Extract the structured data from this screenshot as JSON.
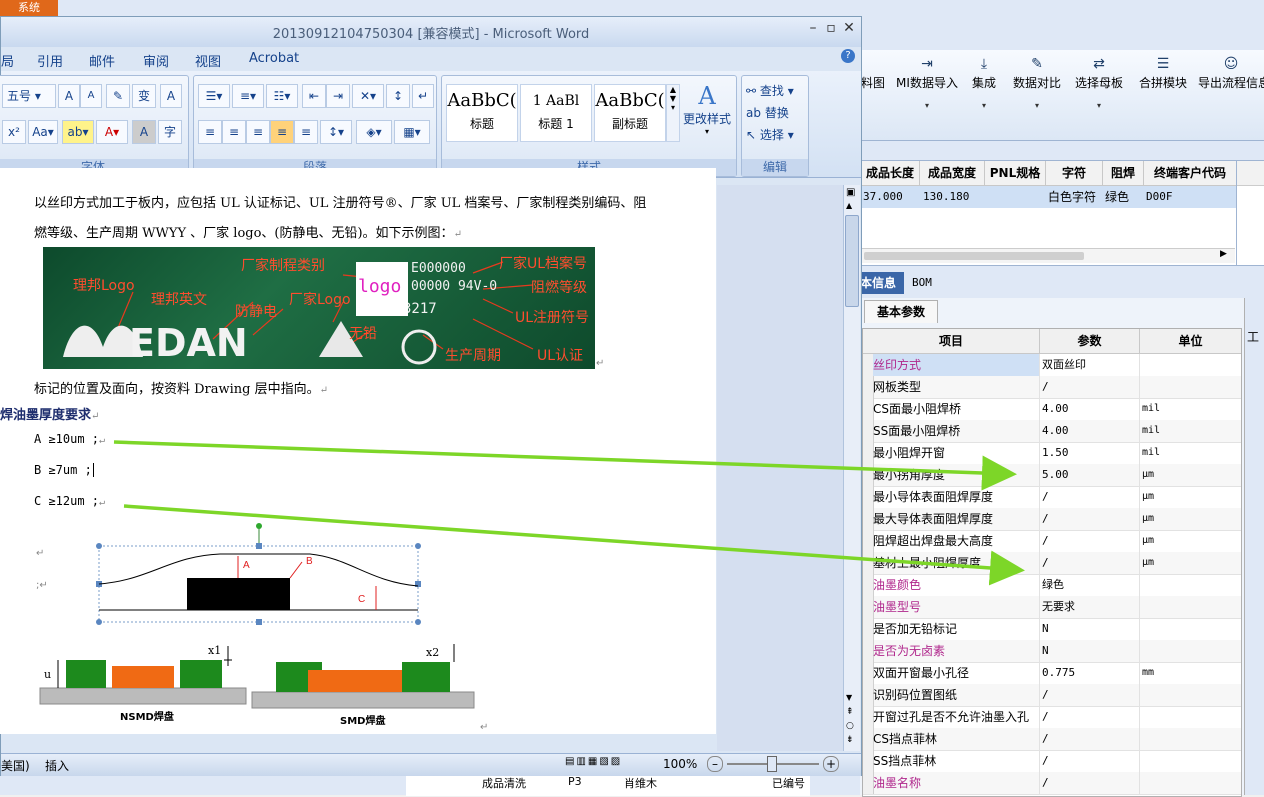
{
  "system_tab": "系统",
  "word": {
    "title": "20130912104750304 [兼容模式] - Microsoft Word",
    "menus": [
      "局",
      "引用",
      "邮件",
      "审阅",
      "视图",
      "Acrobat"
    ],
    "font_size_value": "五号",
    "groups": {
      "font": "字体",
      "paragraph": "段落",
      "styles": "样式",
      "editing": "编辑"
    },
    "styles": [
      {
        "sample": "AaBbC(",
        "name": "标题"
      },
      {
        "sample": "1   AaBl",
        "name": "标题 1"
      },
      {
        "sample": "AaBbC(",
        "name": "副标题"
      }
    ],
    "change_styles": "更改样式",
    "editing": {
      "find": "查找",
      "replace": "替换",
      "select": "选择"
    },
    "doc": {
      "line1": "以丝印方式加工于板内，应包括 UL 认证标记、UL 注册符号®、厂家 UL 档案号、厂家制程类别编码、阻",
      "line2": "燃等级、生产周期 WWYY 、厂家 logo、(防静电、无铅)。如下示例图：",
      "photo_labels": {
        "liban_logo": "理邦Logo",
        "liban_en": "理邦英文",
        "antistatic": "防静电",
        "vendor_logo": "厂家Logo",
        "process": "厂家制程类别",
        "ul_file": "厂家UL档案号",
        "flame": "阻燃等级",
        "ul_reg": "UL注册符号",
        "leadfree": "无铅",
        "period": "生产周期",
        "ul_cert": "UL认证",
        "logo": "logo",
        "brand": "EDAN",
        "code1": "E000000",
        "code2": "00000 94V-0",
        "code3": "3217"
      },
      "line3": "标记的位置及面向，按资料 Drawing 层中指向。",
      "heading": "焊油墨厚度要求",
      "items": [
        "A ≥10um ;",
        "B ≥7um ;",
        "C ≥12um ;"
      ],
      "diagram_labels": {
        "a": "A",
        "b": "B",
        "c": "C",
        "x1": "x1",
        "x2": "x2",
        "u": "u",
        "nsmd": "NSMD焊盘",
        "smd": "SMD焊盘"
      }
    },
    "status": {
      "lang": "美国)",
      "insert": "插入",
      "zoom": "100%"
    }
  },
  "app": {
    "toolbar": [
      {
        "label": "料图",
        "icon": "chart-icon"
      },
      {
        "label": "MI数据导入",
        "icon": "import-icon"
      },
      {
        "label": "集成",
        "icon": "download-icon"
      },
      {
        "label": "数据对比",
        "icon": "compare-icon"
      },
      {
        "label": "选择母板",
        "icon": "shuffle-icon"
      },
      {
        "label": "合拼模块",
        "icon": "list-icon"
      },
      {
        "label": "导出流程信息",
        "icon": "smile-icon"
      }
    ],
    "grid1": {
      "headers": [
        "成品长度",
        "成品宽度",
        "PNL规格",
        "字符",
        "阻焊",
        "终端客户代码"
      ],
      "row": [
        "37.000",
        "130.180",
        "",
        "白色字符",
        "绿色",
        "D00F"
      ]
    },
    "panel_tabs": [
      "本信息",
      "BOM"
    ],
    "subtab": "基本参数",
    "param_headers": [
      "项目",
      "参数",
      "单位"
    ],
    "params": [
      {
        "item": "丝印方式",
        "value": "双面丝印",
        "unit": "",
        "pink": true,
        "sel": true
      },
      {
        "item": "网板类型",
        "value": "/",
        "unit": "",
        "pink": false
      },
      {
        "item": "CS面最小阻焊桥",
        "value": "4.00",
        "unit": "mil",
        "pink": false
      },
      {
        "item": "SS面最小阻焊桥",
        "value": "4.00",
        "unit": "mil",
        "pink": false
      },
      {
        "item": "最小阻焊开窗",
        "value": "1.50",
        "unit": "mil",
        "pink": false
      },
      {
        "item": "最小拐角厚度",
        "value": "5.00",
        "unit": "μm",
        "pink": false
      },
      {
        "item": "最小导体表面阻焊厚度",
        "value": "/",
        "unit": "μm",
        "pink": false
      },
      {
        "item": "最大导体表面阻焊厚度",
        "value": "/",
        "unit": "μm",
        "pink": false
      },
      {
        "item": "阻焊超出焊盘最大高度",
        "value": "/",
        "unit": "μm",
        "pink": false
      },
      {
        "item": "基材上最小阻焊厚度",
        "value": "/",
        "unit": "μm",
        "pink": false
      },
      {
        "item": "油墨颜色",
        "value": "绿色",
        "unit": "",
        "pink": true
      },
      {
        "item": "油墨型号",
        "value": "无要求",
        "unit": "",
        "pink": true
      },
      {
        "item": "是否加无铅标记",
        "value": "N",
        "unit": "",
        "pink": false
      },
      {
        "item": "是否为无卤素",
        "value": "N",
        "unit": "",
        "pink": true
      },
      {
        "item": "双面开窗最小孔径",
        "value": "0.775",
        "unit": "mm",
        "pink": false
      },
      {
        "item": "识别码位置图纸",
        "value": "/",
        "unit": "",
        "pink": false
      },
      {
        "item": "开窗过孔是否不允许油墨入孔",
        "value": "/",
        "unit": "",
        "pink": false
      },
      {
        "item": "CS挡点菲林",
        "value": "/",
        "unit": "",
        "pink": false
      },
      {
        "item": "SS挡点菲林",
        "value": "/",
        "unit": "",
        "pink": false
      },
      {
        "item": "油墨名称",
        "value": "/",
        "unit": "",
        "pink": true
      }
    ],
    "bottom_row": [
      "成品清洗",
      "P3",
      "肖维木",
      "已编号"
    ]
  },
  "colors": {
    "arrow": "#7dd628",
    "pink": "#b0278c",
    "accent": "#15428b"
  }
}
